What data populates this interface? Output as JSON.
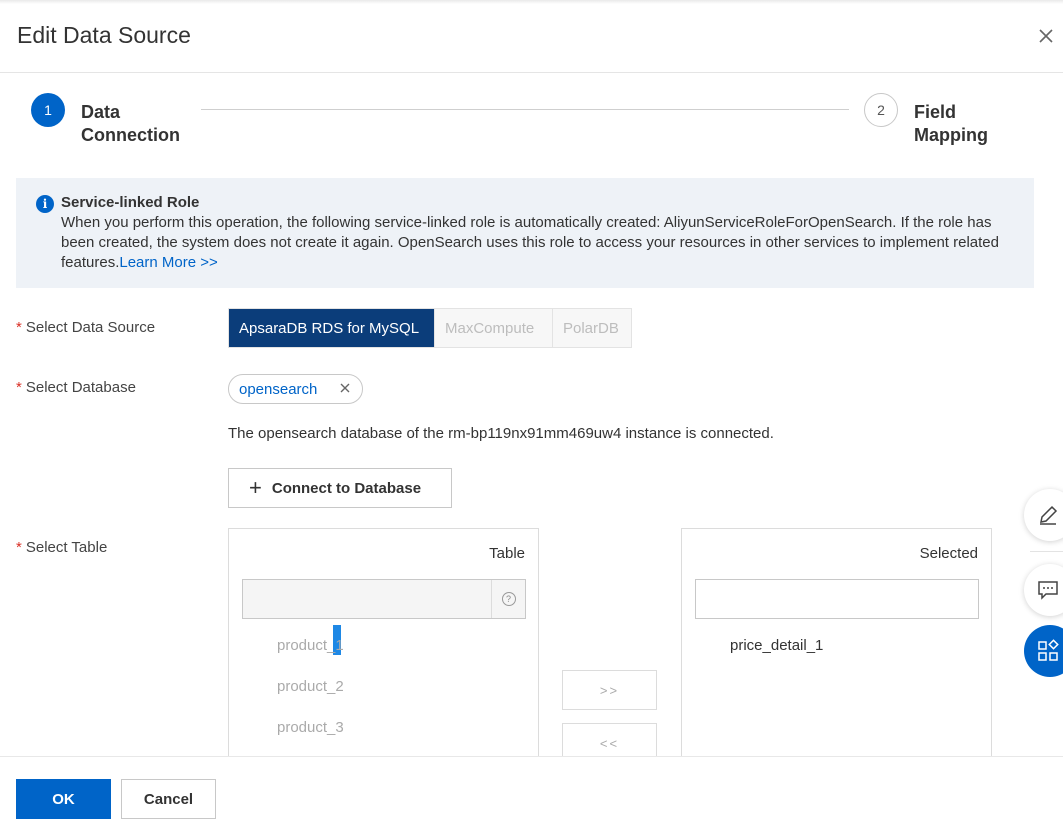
{
  "dialog": {
    "title": "Edit Data Source"
  },
  "steps": [
    {
      "number": "1",
      "label": "Data Connection",
      "state": "active"
    },
    {
      "number": "2",
      "label": "Field Mapping",
      "state": "pending"
    }
  ],
  "notice": {
    "title": "Service-linked Role",
    "body": "When you perform this operation, the following service-linked role is automatically created: AliyunServiceRoleForOpenSearch. If the role has been created, the system does not create it again. OpenSearch uses this role to access your resources in other services to implement related features.",
    "link": "Learn More >>"
  },
  "form": {
    "data_source": {
      "label": "Select Data Source",
      "options": [
        "ApsaraDB RDS for MySQL",
        "MaxCompute",
        "PolarDB"
      ],
      "selected": "ApsaraDB RDS for MySQL"
    },
    "database": {
      "label": "Select Database",
      "tag": "opensearch",
      "status": "The opensearch database of the rm-bp119nx91mm469uw4 instance is connected.",
      "connect_button": "Connect to Database"
    },
    "table": {
      "label": "Select Table",
      "left_header": "Table",
      "right_header": "Selected",
      "left_items": [
        "product_1",
        "product_2",
        "product_3"
      ],
      "right_items": [
        "price_detail_1"
      ],
      "move_right": ">>",
      "move_left": "<<"
    }
  },
  "footer": {
    "ok": "OK",
    "cancel": "Cancel"
  },
  "colors": {
    "primary": "#0064c8",
    "segment_active": "#0b3d7a",
    "required": "#d93026",
    "notice_bg": "#eef2f7"
  }
}
